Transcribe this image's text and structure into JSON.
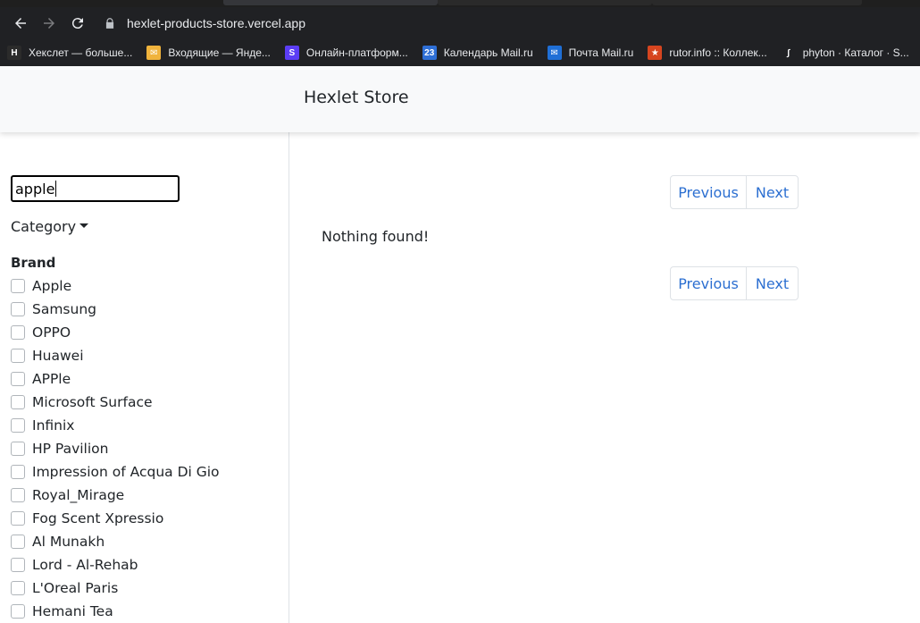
{
  "browser": {
    "url": "hexlet-products-store.vercel.app",
    "bookmarks": [
      {
        "label": "Хекслет — больше...",
        "icon": "hexlet-icon",
        "color": "#2b2b2b",
        "glyph": "H"
      },
      {
        "label": "Входящие — Янде...",
        "icon": "mail-icon",
        "color": "#f0b33c",
        "glyph": "✉"
      },
      {
        "label": "Онлайн-платформ...",
        "icon": "skillbox-icon",
        "color": "#5b3df5",
        "glyph": "S"
      },
      {
        "label": "Календарь Mail.ru",
        "icon": "calendar-icon",
        "color": "#2e6fd6",
        "glyph": "23"
      },
      {
        "label": "Почта Mail.ru",
        "icon": "mailru-icon",
        "color": "#1f6fd6",
        "glyph": "✉"
      },
      {
        "label": "rutor.info :: Коллек...",
        "icon": "rutor-icon",
        "color": "#d6451f",
        "glyph": "★"
      },
      {
        "label": "phyton · Каталог · S...",
        "icon": "stepik-icon",
        "color": "#202124",
        "glyph": "∫"
      }
    ]
  },
  "navbar": {
    "brand": "Hexlet Store"
  },
  "sidebar": {
    "search_value": "apple",
    "category_label": "Category",
    "brand_title": "Brand",
    "brands": [
      "Apple",
      "Samsung",
      "OPPO",
      "Huawei",
      "APPle",
      "Microsoft Surface",
      "Infinix",
      "HP Pavilion",
      "Impression of Acqua Di Gio",
      "Royal_Mirage",
      "Fog Scent Xpressio",
      "Al Munakh",
      "Lord - Al-Rehab",
      "L'Oreal Paris",
      "Hemani Tea"
    ]
  },
  "main": {
    "previous_label": "Previous",
    "next_label": "Next",
    "empty_message": "Nothing found!"
  }
}
